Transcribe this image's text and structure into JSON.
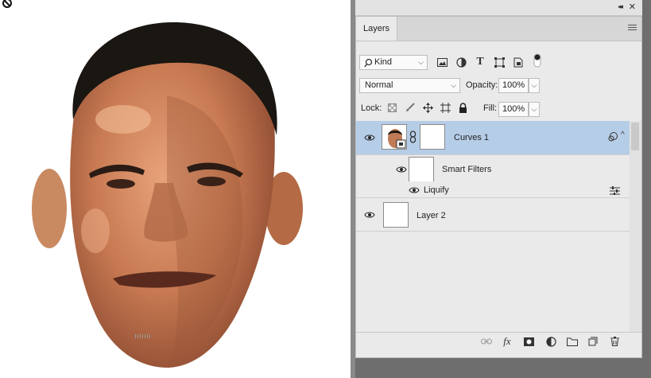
{
  "panel": {
    "tab_label": "Layers",
    "filter_kind": "Kind",
    "blend_mode": "Normal",
    "opacity_label": "Opacity:",
    "opacity_value": "100%",
    "lock_label": "Lock:",
    "fill_label": "Fill:",
    "fill_value": "100%"
  },
  "layers": [
    {
      "name": "Curves 1",
      "selected": true
    },
    {
      "name": "Smart Filters"
    },
    {
      "name": "Liquify"
    },
    {
      "name": "Layer 2"
    }
  ],
  "colors": {
    "selection": "#b6cde8",
    "panel_bg": "#eaeaea",
    "app_bg": "#6e6e6e"
  },
  "icons": [
    "no-entry-icon",
    "collapse-icon",
    "close-icon",
    "panel-menu-icon",
    "search-icon",
    "pixel-filter-icon",
    "adjustment-filter-icon",
    "type-filter-icon",
    "shape-filter-icon",
    "smartobject-filter-icon",
    "filter-toggle-icon",
    "lock-transparent-icon",
    "lock-paint-icon",
    "lock-position-icon",
    "lock-artboard-icon",
    "lock-all-icon",
    "eye-icon",
    "link-icon",
    "smart-object-badge-icon",
    "clip-icon",
    "expand-icon",
    "filter-options-icon",
    "link-layers-icon",
    "fx-icon",
    "mask-icon",
    "new-adjustment-icon",
    "new-group-icon",
    "new-layer-icon",
    "trash-icon"
  ]
}
